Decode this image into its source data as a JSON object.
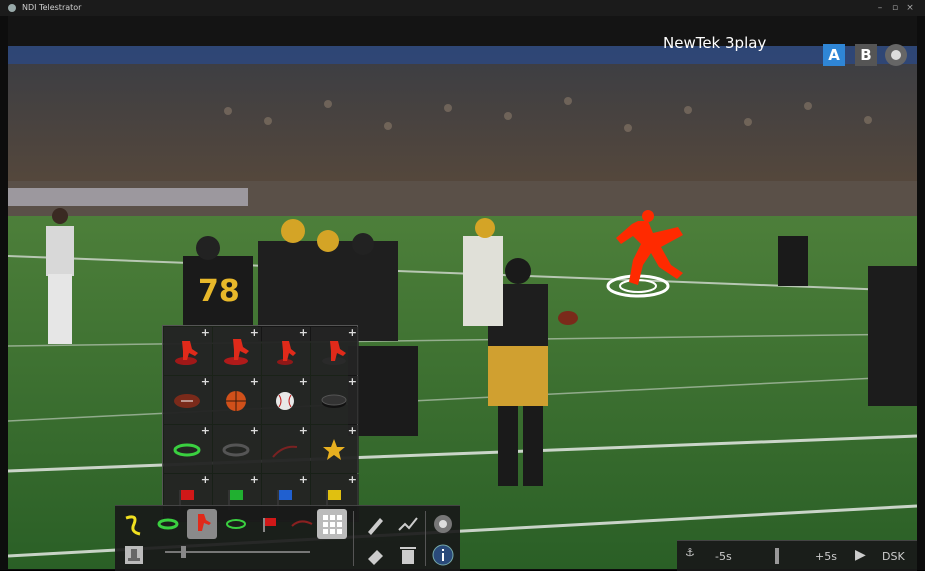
{
  "window": {
    "title": "NDI Telestrator"
  },
  "overlay": {
    "brand": "NewTek 3play",
    "buttons": {
      "a": "A",
      "b": "B"
    }
  },
  "palette": {
    "rows": [
      [
        "player-red-base-icon",
        "player-red-disc-icon",
        "player-red-small-icon",
        "player-red-hat-icon"
      ],
      [
        "football-icon",
        "basketball-icon",
        "baseball-icon",
        "hockey-puck-icon"
      ],
      [
        "green-ring-icon",
        "dark-ring-icon",
        "red-arrow-icon",
        "star-icon"
      ],
      [
        "red-flag-icon",
        "green-flag-icon",
        "blue-flag-icon",
        "yellow-flag-icon"
      ]
    ],
    "plus": "+"
  },
  "toolbar": {
    "icons": [
      "yellow-curve-icon",
      "green-ring-tool-icon",
      "red-player-tool-icon",
      "ring-tool-icon",
      "red-flag-tool-icon",
      "red-line-tool-icon",
      "grid-toggle-icon",
      "pen-icon",
      "freehand-icon",
      "settings-icon",
      "stamp-icon",
      "eraser-icon",
      "trash-icon",
      "info-icon"
    ]
  },
  "timeline": {
    "back": "-5s",
    "forward": "+5s",
    "dsk": "DSK"
  },
  "colors": {
    "accent": "#2f86d6",
    "marker": "#ff2a00"
  }
}
